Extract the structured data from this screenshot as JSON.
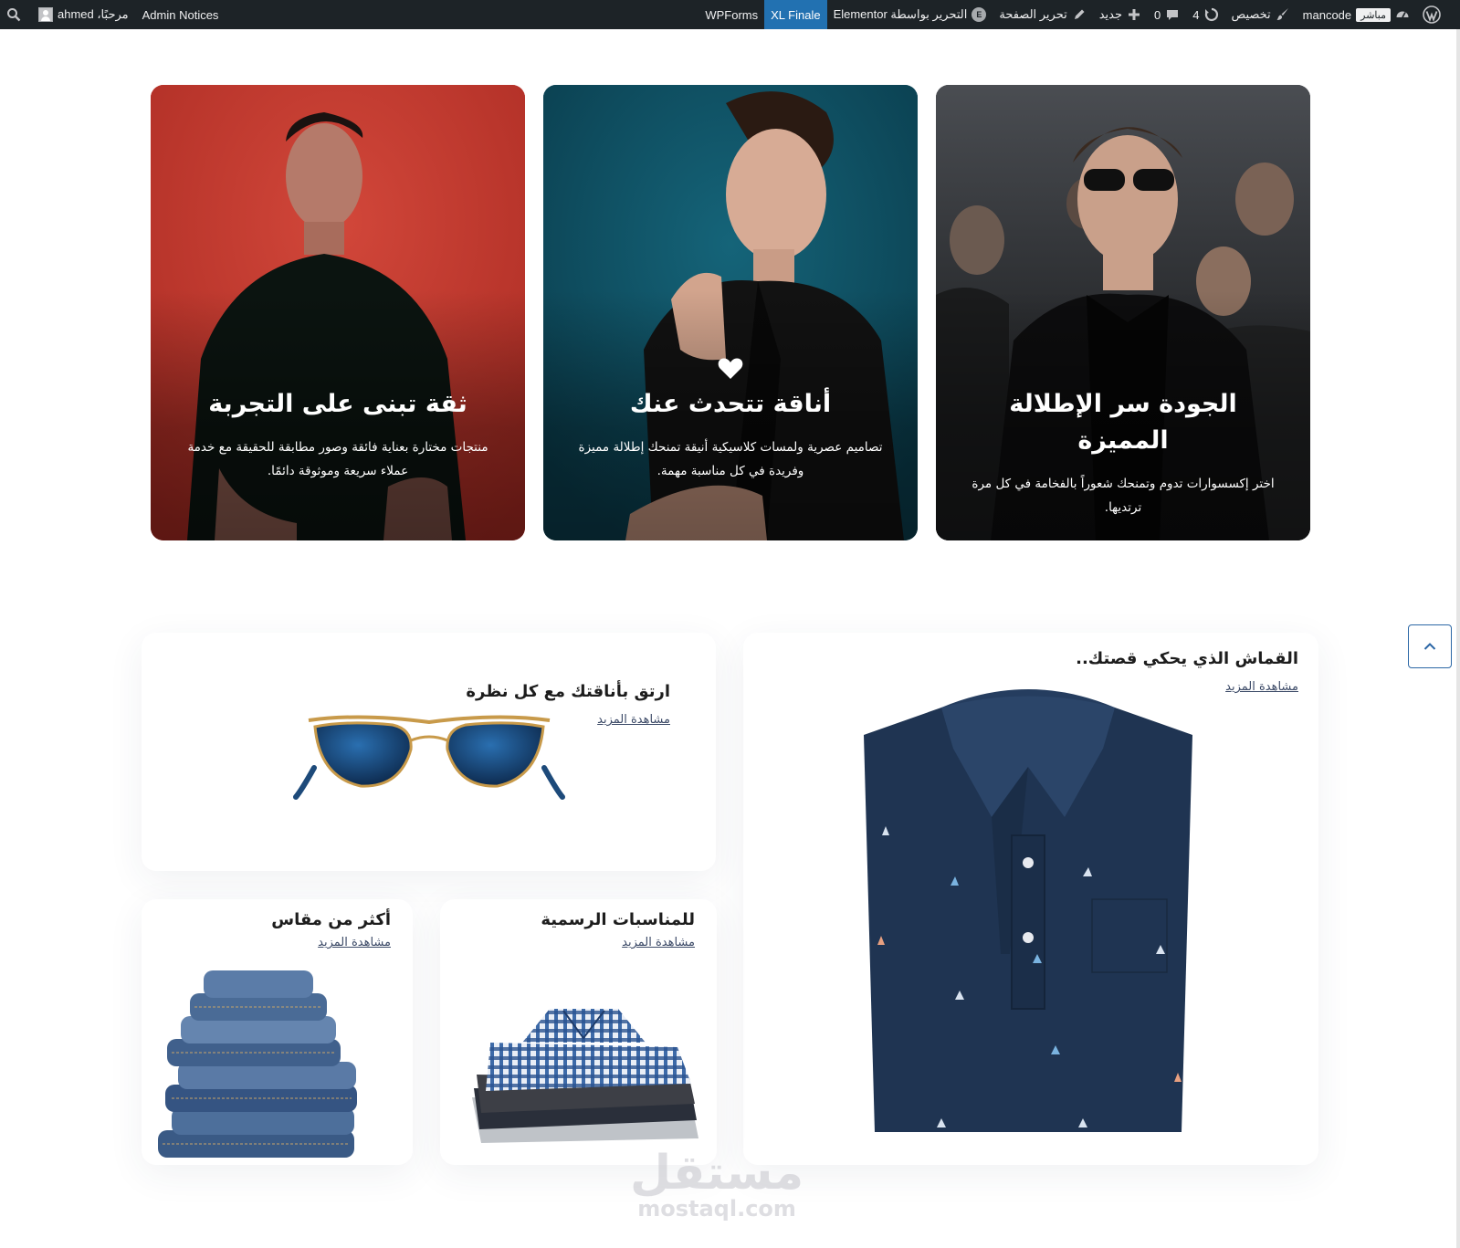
{
  "adminbar": {
    "site_name": "mancode",
    "live_badge": "مباشر",
    "customize": "تخصيص",
    "updates_count": "4",
    "comments_count": "0",
    "new": "جديد",
    "edit_page": "تحرير الصفحة",
    "edit_elementor": "التحرير بواسطة Elementor",
    "xl_finale": "XL Finale",
    "wpforms": "WPForms",
    "admin_notices": "Admin Notices",
    "greeting": "مرحبًا، ahmed"
  },
  "hero_cards": [
    {
      "title": "الجودة سر الإطلالة المميزة",
      "description": "اختر إكسسوارات تدوم وتمنحك شعوراً بالفخامة في كل مرة ترتديها.",
      "background": "#2b2d30"
    },
    {
      "title": "أناقة تتحدث عنك",
      "description": "تصاميم عصرية ولمسات كلاسيكية أنيقة تمنحك إطلالة مميزة وفريدة في كل مناسبة مهمة.",
      "background": "#0f4f63"
    },
    {
      "title": "ثقة تبنى على التجربة",
      "description": "منتجات مختارة بعناية فائقة وصور مطابقة للحقيقة مع خدمة عملاء سريعة وموثوقة دائمًا.",
      "background": "#c4382f"
    }
  ],
  "promos": {
    "fabric": {
      "title": "القماش الذي يحكي قصتك..",
      "link": "مشاهدة المزيد"
    },
    "glasses": {
      "title": "ارتق بأناقتك مع كل نظرة",
      "link": "مشاهدة المزيد"
    },
    "formal": {
      "title": "للمناسبات الرسمية",
      "link": "مشاهدة المزيد"
    },
    "sizes": {
      "title": "أكثر من مقاس",
      "link": "مشاهدة المزيد"
    }
  },
  "watermark": {
    "arabic": "مستقل",
    "latin": "mostaql.com"
  },
  "colors": {
    "adminbar": "#1d2327",
    "accent": "#2271b1",
    "link": "#3c4a67",
    "polo": "#1f3452"
  }
}
